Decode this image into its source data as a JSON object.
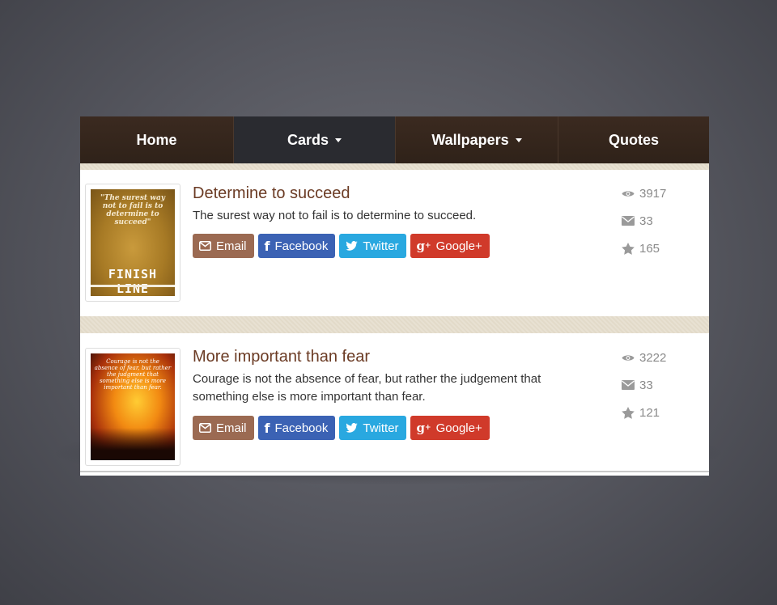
{
  "nav": {
    "items": [
      {
        "label": "Home",
        "dropdown": false
      },
      {
        "label": "Cards",
        "dropdown": true,
        "active": true
      },
      {
        "label": "Wallpapers",
        "dropdown": true
      },
      {
        "label": "Quotes",
        "dropdown": false
      }
    ]
  },
  "share_labels": {
    "email": "Email",
    "facebook": "Facebook",
    "twitter": "Twitter",
    "google": "Google+"
  },
  "colors": {
    "nav_bg": "#3b2a20",
    "nav_active": "#2a2b30",
    "title": "#6b3b24",
    "email": "#9b6a52",
    "facebook": "#3b62b4",
    "twitter": "#29a8e0",
    "google": "#d03a2a"
  },
  "cards": [
    {
      "title": "Determine to succeed",
      "description": "The surest way not to fail is to determine to succeed.",
      "thumbnail": {
        "quote": "\"The surest way not to fail is to determine to succeed\"",
        "caption": "FINISH LINE"
      },
      "stats": {
        "views": "3917",
        "emails": "33",
        "stars": "165"
      }
    },
    {
      "title": "More important than fear",
      "description": "Courage is not the absence of fear, but rather the judgement that something else is more important than fear.",
      "thumbnail": {
        "quote": "Courage is not the absence of fear, but rather the judgment that something else is more important than fear."
      },
      "stats": {
        "views": "3222",
        "emails": "33",
        "stars": "121"
      }
    }
  ]
}
